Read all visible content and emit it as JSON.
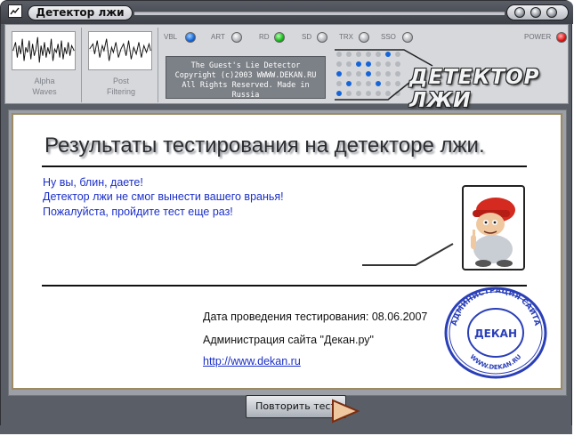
{
  "window": {
    "title": "Детектор лжи"
  },
  "panel": {
    "waves": [
      {
        "label_line1": "Alpha",
        "label_line2": "Waves"
      },
      {
        "label_line1": "Post",
        "label_line2": "Filtering"
      }
    ],
    "indicators": [
      {
        "label": "VBL",
        "state": "blue"
      },
      {
        "label": "ART",
        "state": "off"
      },
      {
        "label": "RD",
        "state": "green"
      },
      {
        "label": "SD",
        "state": "off"
      },
      {
        "label": "TRX",
        "state": "off"
      },
      {
        "label": "SSO",
        "state": "off"
      },
      {
        "label": "POWER",
        "state": "red"
      }
    ],
    "copyright": {
      "line1": "The Guest's Lie Detector",
      "line2": "Copyright (c)2003 WWWW.DEKAN.RU",
      "line3": "All Rights Reserved. Made in Russia"
    },
    "logo": "ДЕТЕКТОР ЛЖИ"
  },
  "main": {
    "heading": "Результаты тестирования на детекторе лжи.",
    "message_lines": [
      "Ну вы, блин, даете!",
      "Детектор лжи не смог вынести вашего вранья!",
      "Пожалуйста, пройдите тест еще раз!"
    ],
    "test_date": "Дата проведения тестирования: 08.06.2007",
    "admin": "Администрация сайта \"Декан.ру\"",
    "link": "http://www.dekan.ru"
  },
  "stamp": {
    "outer_text": "АДМИНИСТРАЦИЯ САЙТА",
    "bottom_text": "WWW.DEKAN.RU",
    "center_text": "ДЕКАН"
  },
  "footer": {
    "repeat_button": "Повторить тест"
  },
  "colors": {
    "accent_blue": "#1b2fc9",
    "led_blue": "#1565d8",
    "led_green": "#16b81a",
    "led_red": "#e01010",
    "stamp_blue": "#2a3fb8"
  }
}
